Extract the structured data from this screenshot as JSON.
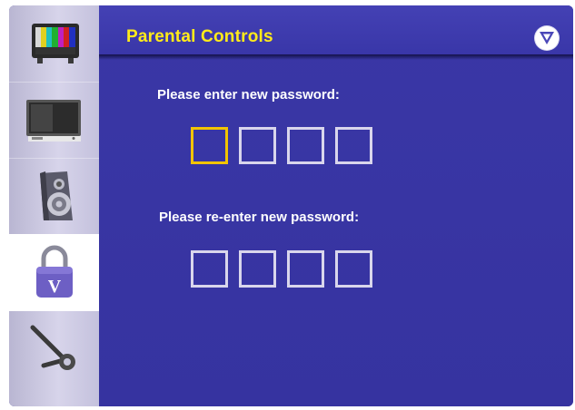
{
  "title": "Parental Controls",
  "prompts": {
    "enter": "Please enter new password:",
    "reenter": "Please re-enter new password:"
  },
  "password": {
    "entry_boxes": [
      "",
      "",
      "",
      ""
    ],
    "confirm_boxes": [
      "",
      "",
      "",
      ""
    ]
  },
  "sidebar": {
    "items": [
      {
        "name": "picture",
        "icon": "tv-color-bars-icon",
        "active": false
      },
      {
        "name": "display",
        "icon": "monitor-icon",
        "active": false
      },
      {
        "name": "audio",
        "icon": "speaker-icon",
        "active": false
      },
      {
        "name": "parental",
        "icon": "padlock-icon",
        "active": true
      },
      {
        "name": "setup",
        "icon": "wrench-icon",
        "active": false
      }
    ]
  },
  "colors": {
    "panel": "#3b38a3",
    "title": "#ffeb1a",
    "focus_box": "#f2c400",
    "box": "#d9d6ec"
  }
}
